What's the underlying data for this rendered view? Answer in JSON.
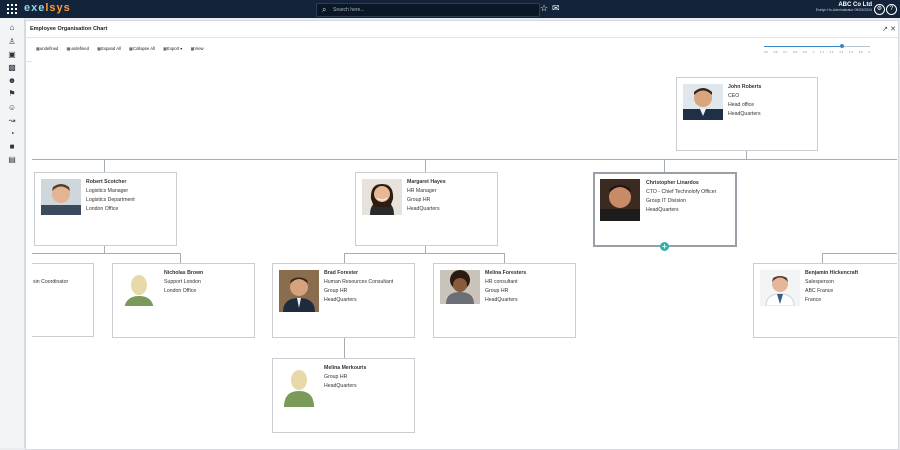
{
  "topbar": {
    "logo_part1": "exe",
    "logo_part2": "lsys",
    "search_placeholder": "Search here...",
    "company": "ABC Co Ltd",
    "company_sub": "Evelyn Ho-Administrator 09/03/2024"
  },
  "panel": {
    "title": "Employee Organisation Chart"
  },
  "toolbar": {
    "items": [
      "undefined",
      "undefined",
      "Expand All",
      "Collapse All",
      "Export ▾",
      "View"
    ]
  },
  "zoom": {
    "level_fraction": 0.74,
    "ticks": [
      "0.5",
      "0.6",
      "0.7",
      "0.8",
      "0.9",
      "1",
      "1.1",
      "1.2",
      "1.3",
      "1.4",
      "1.5",
      "2"
    ]
  },
  "people": {
    "ceo": {
      "name": "John Roberts",
      "lines": [
        "CEO",
        "Head office",
        "HeadQuarters"
      ]
    },
    "robert": {
      "name": "Robert Scotcher",
      "lines": [
        "Logistics Manager",
        "Logistics Department",
        "London Office"
      ]
    },
    "margaret": {
      "name": "Margaret Hayes",
      "lines": [
        "HR Manager",
        "Group HR",
        "HeadQuarters"
      ]
    },
    "christopher": {
      "name": "Christopher Linardos",
      "lines": [
        "CTO - Chief Technolofy Officer",
        "Group IT Division",
        "HeadQuarters"
      ]
    },
    "partial": {
      "name": "",
      "lines": [
        "sin Coordinator"
      ]
    },
    "nicholas": {
      "name": "Nicholas Brown",
      "lines": [
        "Support London",
        "London Office"
      ]
    },
    "brad": {
      "name": "Brad Forester",
      "lines": [
        "Human Resources Consultant",
        "Group HR",
        "HeadQuarters"
      ]
    },
    "melina": {
      "name": "Melina Foresters",
      "lines": [
        "HR consultant",
        "Group HR",
        "HeadQuarters"
      ]
    },
    "benjamin": {
      "name": "Benjamin Hickencraft",
      "lines": [
        "Salesperson",
        "ABC France",
        "France"
      ]
    },
    "merkouris": {
      "name": "Melina Merkouris",
      "lines": [
        "Group HR",
        "HeadQuarters"
      ]
    }
  },
  "colors": {
    "accent": "#2ab3a6",
    "topbar": "#13243a",
    "zoom": "#3a86c8"
  }
}
